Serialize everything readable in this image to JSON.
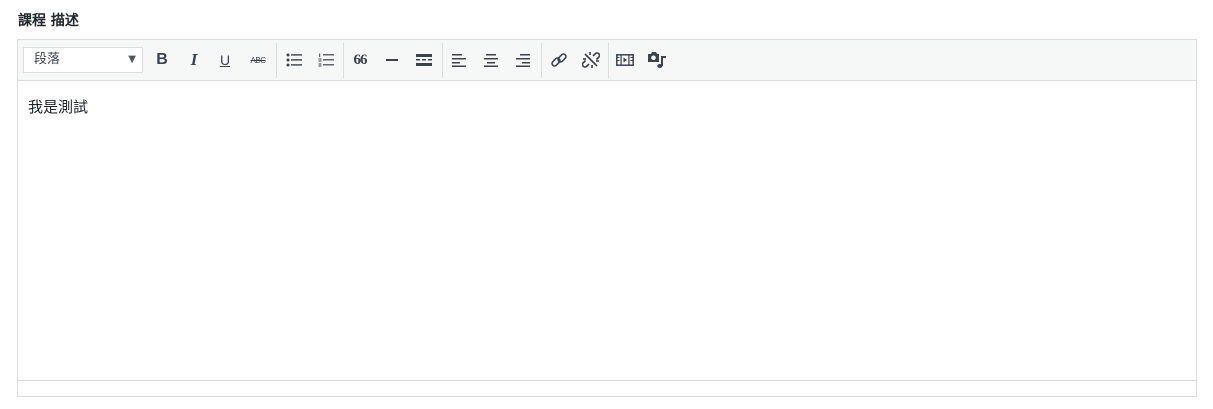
{
  "field": {
    "label": "課程 描述"
  },
  "toolbar": {
    "format_select": {
      "selected": "段落"
    },
    "buttons": [
      {
        "icon": "bold-icon",
        "glyph": "B"
      },
      {
        "icon": "italic-icon",
        "glyph": "I"
      },
      {
        "icon": "underline-icon",
        "glyph": "U"
      },
      {
        "icon": "strikethrough-icon",
        "glyph": "ABC"
      },
      {
        "icon": "bullet-list-icon"
      },
      {
        "icon": "numbered-list-icon"
      },
      {
        "icon": "blockquote-icon",
        "glyph": "66"
      },
      {
        "icon": "horizontal-rule-icon"
      },
      {
        "icon": "read-more-icon"
      },
      {
        "icon": "align-left-icon"
      },
      {
        "icon": "align-center-icon"
      },
      {
        "icon": "align-right-icon"
      },
      {
        "icon": "insert-link-icon"
      },
      {
        "icon": "remove-link-icon"
      },
      {
        "icon": "insert-video-icon"
      },
      {
        "icon": "insert-media-icon"
      }
    ]
  },
  "content": {
    "text": "我是測試"
  },
  "colors": {
    "toolbar_bg": "#f6f7f7",
    "border": "#dcdcde",
    "icon": "#3c434a",
    "text": "#1d2327"
  }
}
